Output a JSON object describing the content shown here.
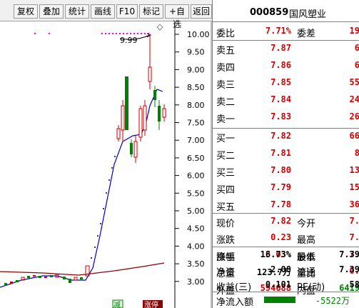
{
  "toolbar": {
    "buttons": [
      "复权",
      "叠加",
      "统计",
      "画线",
      "F10",
      "标记",
      "+自选",
      "返回"
    ]
  },
  "chart": {
    "price_ticks": [
      "10.00",
      "9.50",
      "9.00",
      "8.50",
      "8.00",
      "7.50",
      "7.00",
      "6.50",
      "6.00",
      "5.50",
      "5.00",
      "4.50",
      "4.00",
      "3.50",
      "3.00"
    ],
    "high_label": "9.99",
    "badge_a": "减",
    "badge_b": "涨停"
  },
  "stock": {
    "code": "000859",
    "name": "国风塑业"
  },
  "quote": {
    "weibi_label": "委比",
    "weibi": "7.71%",
    "weicha_label": "委差",
    "weicha": "19",
    "sell": [
      {
        "label": "卖五",
        "price": "7.87",
        "vol": "6"
      },
      {
        "label": "卖四",
        "price": "7.86",
        "vol": "6"
      },
      {
        "label": "卖三",
        "price": "7.85",
        "vol": "55"
      },
      {
        "label": "卖二",
        "price": "7.84",
        "vol": "24"
      },
      {
        "label": "卖一",
        "price": "7.83",
        "vol": "26"
      }
    ],
    "buy": [
      {
        "label": "买一",
        "price": "7.82",
        "vol": "66"
      },
      {
        "label": "买二",
        "price": "7.81",
        "vol": "8"
      },
      {
        "label": "买三",
        "price": "7.80",
        "vol": "13"
      },
      {
        "label": "买四",
        "price": "7.79",
        "vol": "15"
      },
      {
        "label": "买五",
        "price": "7.78",
        "vol": "36"
      }
    ],
    "stats1": [
      {
        "l1": "现价",
        "v1": "7.82",
        "l2": "今开",
        "v2": "7."
      },
      {
        "l1": "涨跌",
        "v1": "0.23",
        "l2": "最高",
        "v2": "7."
      },
      {
        "l1": "涨幅",
        "v1": "3.03%",
        "l2": "最低",
        "v2": "7."
      },
      {
        "l1": "总量",
        "v1": "123.7万",
        "l2": "量比",
        "v2": "0."
      },
      {
        "l1": "外盘",
        "v1": "594688",
        "l2": "内盘",
        "v2": "6419"
      }
    ],
    "stats2": [
      {
        "l1": "换手",
        "v1": "16.73%",
        "l2": "股本",
        "v2": "7.39"
      },
      {
        "l1": "净资",
        "v1": "2.08",
        "l2": "流通",
        "v2": "7.39"
      },
      {
        "l1": "收益(三)",
        "v1": "0.101",
        "l2": "PE(动)",
        "v2": "58"
      }
    ],
    "netflow_label": "净流入额",
    "netflow_value": "-5522万"
  }
}
